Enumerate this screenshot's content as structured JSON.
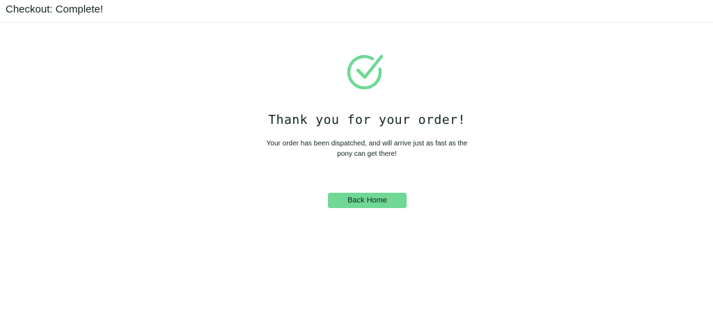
{
  "header": {
    "title": "Checkout: Complete!"
  },
  "main": {
    "icon": "check-circle-icon",
    "heading": "Thank you for your order!",
    "message": "Your order has been dispatched, and will arrive just as fast as the pony can get there!",
    "button_label": "Back Home"
  },
  "colors": {
    "accent": "#6fd894",
    "text": "#132322",
    "background": "#ffffff",
    "divider": "#ececec"
  }
}
